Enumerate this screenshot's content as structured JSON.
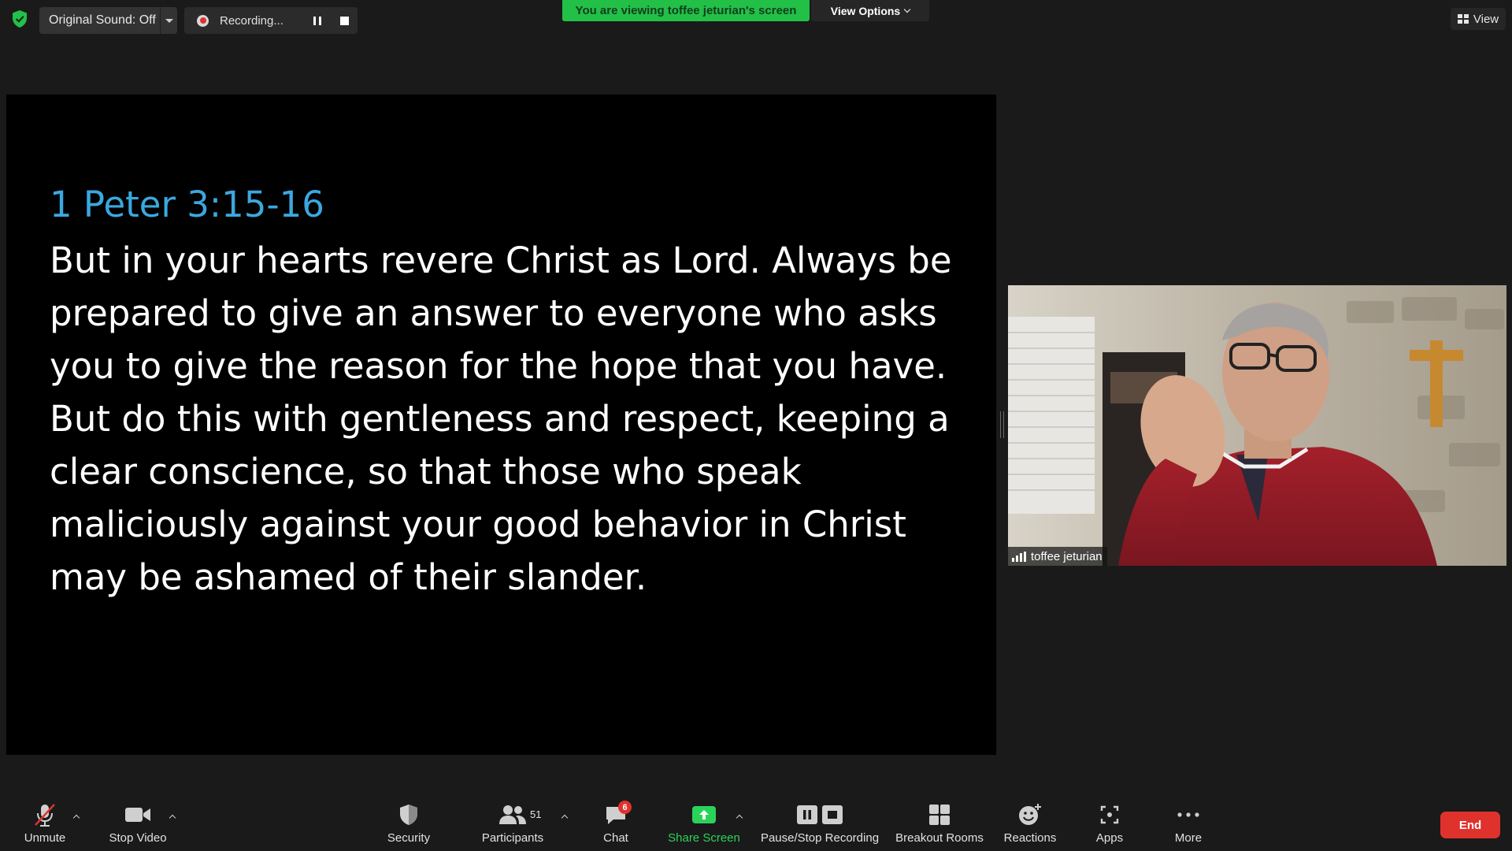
{
  "top_bar": {
    "original_sound_label": "Original Sound: Off",
    "recording_label": "Recording...",
    "viewing_banner": "You are viewing toffee jeturian's screen",
    "view_options_label": "View Options",
    "view_label": "View"
  },
  "shared_screen": {
    "verse_ref": "1 Peter 3:15-16",
    "verse_lines": [
      "But in your hearts revere Christ as Lord. Always be",
      "prepared to give an answer to everyone who asks",
      "you to give the reason for the hope that you have.",
      "But do this with gentleness and respect, keeping a",
      "clear conscience, so that those who speak",
      "maliciously against your good behavior in Christ",
      "may be ashamed of their slander."
    ]
  },
  "participant": {
    "name": "toffee jeturian"
  },
  "toolbar": {
    "unmute_label": "Unmute",
    "stop_video_label": "Stop Video",
    "security_label": "Security",
    "participants_label": "Participants",
    "participants_count": "51",
    "chat_label": "Chat",
    "chat_badge": "6",
    "share_screen_label": "Share Screen",
    "pause_stop_recording_label": "Pause/Stop Recording",
    "breakout_rooms_label": "Breakout Rooms",
    "reactions_label": "Reactions",
    "apps_label": "Apps",
    "more_label": "More",
    "end_label": "End"
  },
  "colors": {
    "background": "#1a1a1a",
    "banner_green": "#22c047",
    "share_green": "#2bd25a",
    "end_red": "#e0322d",
    "verse_blue": "#3ba8df"
  }
}
